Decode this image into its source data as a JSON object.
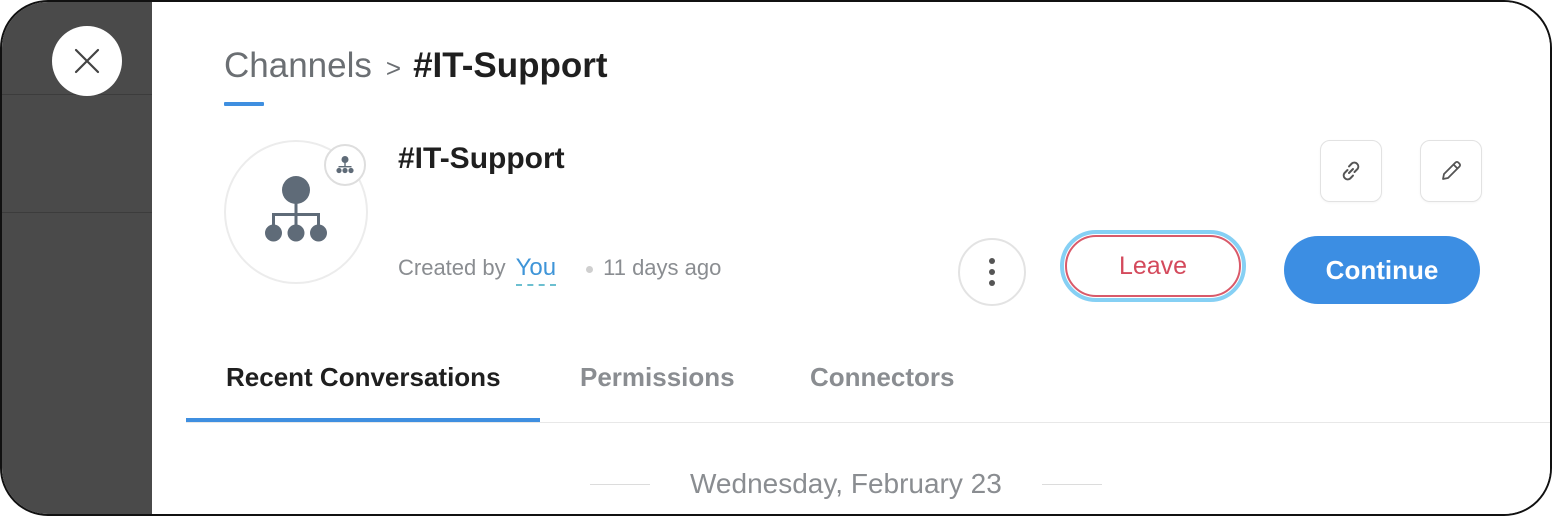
{
  "breadcrumb": {
    "root": "Channels",
    "separator": ">",
    "current": "#IT-Support"
  },
  "channel": {
    "name": "#IT-Support",
    "created_label": "Created by",
    "creator": "You",
    "age": "11 days ago",
    "avatar_icon": "org-chart-icon",
    "badge_icon": "org-chart-mini-icon"
  },
  "actions": {
    "copy_link_icon": "link-icon",
    "edit_icon": "pencil-icon",
    "more_icon": "vertical-ellipsis-icon",
    "leave_label": "Leave",
    "continue_label": "Continue"
  },
  "tabs": [
    {
      "label": "Recent Conversations",
      "active": true
    },
    {
      "label": "Permissions",
      "active": false
    },
    {
      "label": "Connectors",
      "active": false
    }
  ],
  "conversation": {
    "date_label": "Wednesday, February 23"
  },
  "colors": {
    "accent": "#3c8ee3",
    "leave": "#d44a5c",
    "focus_ring": "#86d0f4",
    "backdrop": "#4a4a4a",
    "muted_text": "#8a8d91"
  }
}
